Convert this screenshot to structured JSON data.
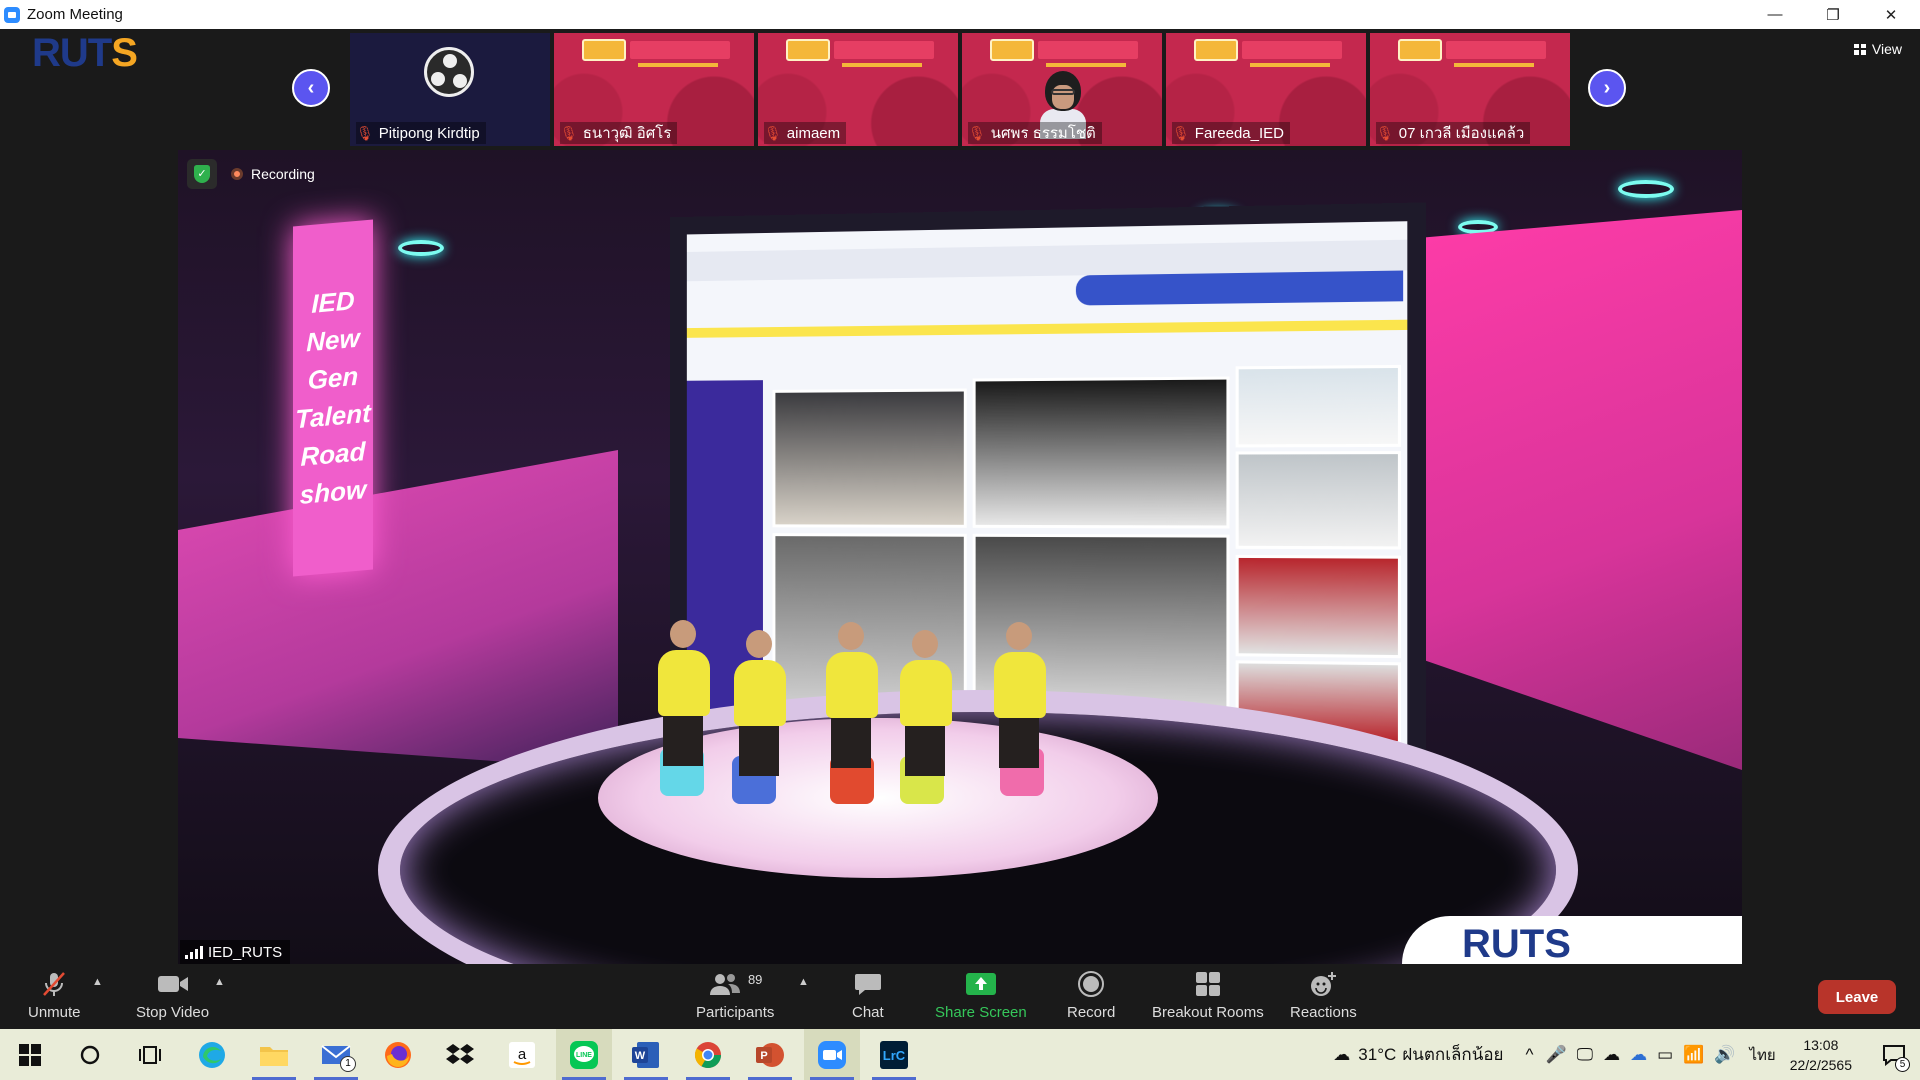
{
  "window": {
    "title": "Zoom Meeting",
    "controls": [
      "—",
      "❐",
      "✕"
    ]
  },
  "logo": {
    "text_main": "RUT",
    "text_accent": "S",
    "subtitle": ""
  },
  "view_label": "View",
  "participants_strip": [
    {
      "name": "Pitipong Kirdtip",
      "type": "obs"
    },
    {
      "name": "ธนาวุฒิ อิศโร",
      "type": "banner"
    },
    {
      "name": "aimaem",
      "type": "banner"
    },
    {
      "name": "นศพร ธรรมโชติ",
      "type": "person"
    },
    {
      "name": "Fareeda_IED",
      "type": "banner"
    },
    {
      "name": "07 เกวลี เมืองแคล้ว",
      "type": "banner"
    }
  ],
  "main_video": {
    "recording_label": "Recording",
    "speaker_name": "IED_RUTS",
    "stage_sign": [
      "IED",
      "New",
      "Gen",
      "Talent",
      "Road",
      "show"
    ]
  },
  "toolbar": {
    "unmute": "Unmute",
    "stop_video": "Stop Video",
    "participants": "Participants",
    "participants_count": "89",
    "chat": "Chat",
    "share_screen": "Share Screen",
    "record": "Record",
    "breakout_rooms": "Breakout Rooms",
    "reactions": "Reactions",
    "leave": "Leave"
  },
  "taskbar": {
    "weather_temp": "31°C",
    "weather_desc": "ฝนตกเล็กน้อย",
    "language": "ไทย",
    "time": "13:08",
    "date": "22/2/2565",
    "notification_count": "5",
    "mail_badge": "1",
    "apps": [
      "windows-start",
      "search",
      "task-view",
      "edge",
      "file-explorer",
      "mail",
      "firefox",
      "dropbox",
      "amazon",
      "line",
      "word",
      "chrome",
      "powerpoint",
      "zoom",
      "lightroom-classic"
    ]
  },
  "colors": {
    "accent": "#5b55f0",
    "leave": "#b8342a",
    "share": "#24b34b",
    "muted_mic": "#e34b33"
  }
}
